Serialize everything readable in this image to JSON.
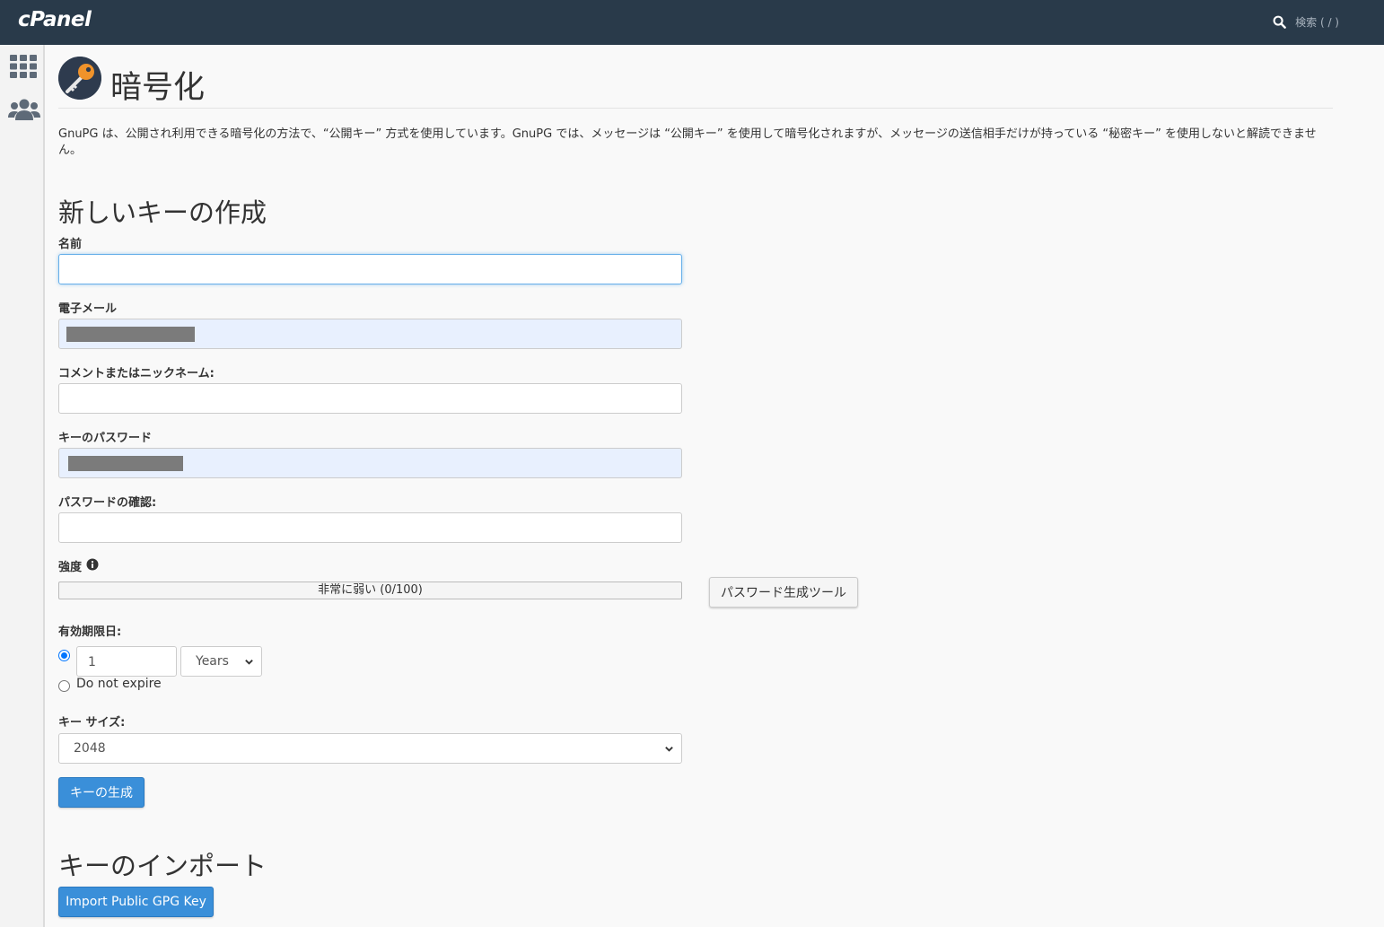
{
  "topbar": {
    "logo": "cPanel",
    "search_placeholder": "検索 ( / )",
    "search_icon": "search-icon"
  },
  "rail": {
    "items": [
      {
        "icon": "grid-icon"
      },
      {
        "icon": "users-icon"
      }
    ]
  },
  "page": {
    "title": "暗号化",
    "icon": "key-icon",
    "description": "GnuPG は、公開され利用できる暗号化の方法で、“公開キー” 方式を使用しています。GnuPG では、メッセージは “公開キー” を使用して暗号化されますが、メッセージの送信相手だけが持っている “秘密キー” を使用しないと解読できません。"
  },
  "create_key": {
    "heading": "新しいキーの作成",
    "name_label": "名前",
    "name_value": "",
    "email_label": "電子メール",
    "comment_label": "コメントまたはニックネーム:",
    "comment_value": "",
    "password_label": "キーのパスワード",
    "confirm_label": "パスワードの確認:",
    "confirm_value": "",
    "strength_label": "強度",
    "strength_text": "非常に弱い (0/100)",
    "strength_value": 0,
    "generator_button": "パスワード生成ツール",
    "expiry_label": "有効期限日:",
    "expiry_value": "1",
    "expiry_unit": "Years",
    "expiry_selected": "custom",
    "no_expire_label": "Do not expire",
    "keysize_label": "キー サイズ:",
    "keysize_value": "2048",
    "submit_button": "キーの生成"
  },
  "import_key": {
    "heading": "キーのインポート",
    "button": "Import Public GPG Key"
  },
  "colors": {
    "topbar": "#293a4a",
    "primary": "#3a8fd9",
    "autofill": "#e8f0fe"
  }
}
